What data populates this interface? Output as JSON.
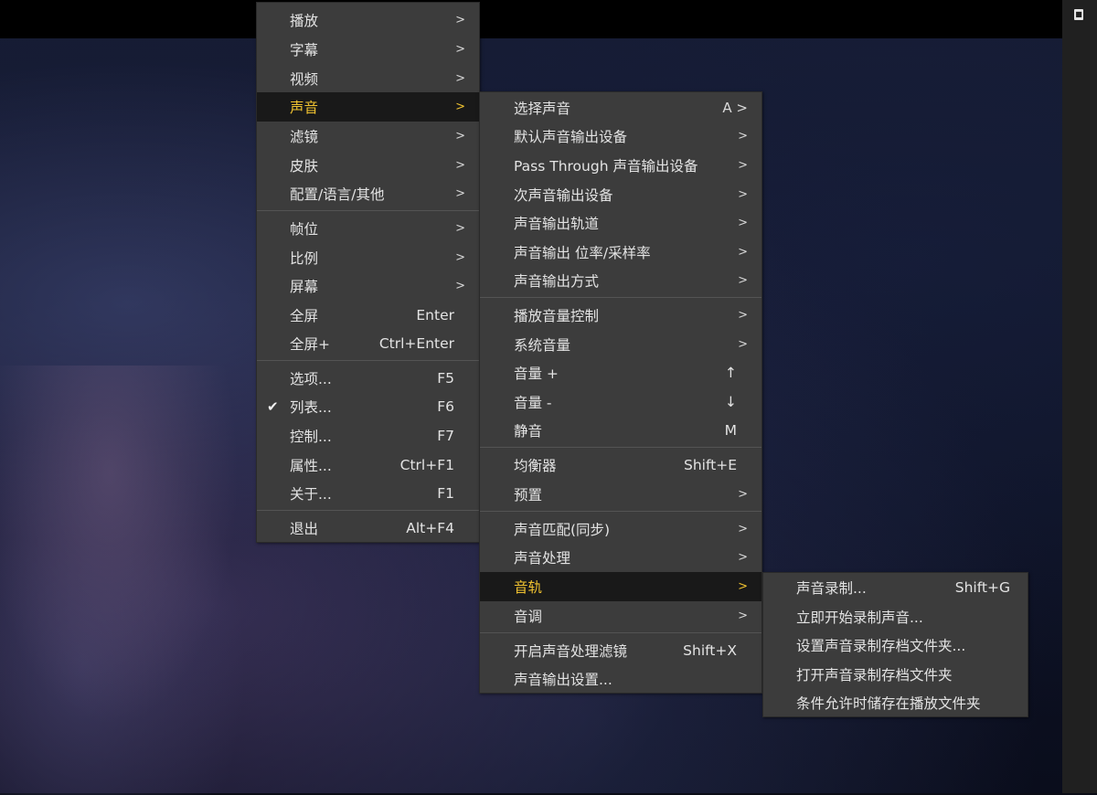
{
  "menu_main": {
    "items": [
      {
        "label": "播放",
        "arrow": ">"
      },
      {
        "label": "字幕",
        "arrow": ">"
      },
      {
        "label": "视频",
        "arrow": ">"
      },
      {
        "label": "声音",
        "arrow": ">"
      },
      {
        "label": "滤镜",
        "arrow": ">"
      },
      {
        "label": "皮肤",
        "arrow": ">"
      },
      {
        "label": "配置/语言/其他",
        "arrow": ">"
      },
      {
        "label": "帧位",
        "arrow": ">"
      },
      {
        "label": "比例",
        "arrow": ">"
      },
      {
        "label": "屏幕",
        "arrow": ">"
      },
      {
        "label": "全屏",
        "shortcut": "Enter"
      },
      {
        "label": "全屏+",
        "shortcut": "Ctrl+Enter"
      },
      {
        "label": "选项...",
        "shortcut": "F5"
      },
      {
        "label": "列表...",
        "shortcut": "F6",
        "checked": true,
        "check_glyph": "✔"
      },
      {
        "label": "控制...",
        "shortcut": "F7"
      },
      {
        "label": "属性...",
        "shortcut": "Ctrl+F1"
      },
      {
        "label": "关于...",
        "shortcut": "F1"
      },
      {
        "label": "退出",
        "shortcut": "Alt+F4"
      }
    ]
  },
  "menu_audio": {
    "items": [
      {
        "label": "选择声音",
        "arrow": "A >"
      },
      {
        "label": "默认声音输出设备",
        "arrow": ">"
      },
      {
        "label": "Pass Through 声音输出设备",
        "arrow": ">"
      },
      {
        "label": "次声音输出设备",
        "arrow": ">"
      },
      {
        "label": "声音输出轨道",
        "arrow": ">"
      },
      {
        "label": "声音输出 位率/采样率",
        "arrow": ">"
      },
      {
        "label": "声音输出方式",
        "arrow": ">"
      },
      {
        "label": "播放音量控制",
        "arrow": ">"
      },
      {
        "label": "系统音量",
        "arrow": ">"
      },
      {
        "label": "音量 +",
        "shortcut": "↑"
      },
      {
        "label": "音量 -",
        "shortcut": "↓"
      },
      {
        "label": "静音",
        "shortcut": "M"
      },
      {
        "label": "均衡器",
        "shortcut": "Shift+E"
      },
      {
        "label": "预置",
        "arrow": ">"
      },
      {
        "label": "声音匹配(同步)",
        "arrow": ">"
      },
      {
        "label": "声音处理",
        "arrow": ">"
      },
      {
        "label": "音轨",
        "arrow": ">"
      },
      {
        "label": "音调",
        "arrow": ">"
      },
      {
        "label": "开启声音处理滤镜",
        "shortcut": "Shift+X"
      },
      {
        "label": "声音输出设置..."
      }
    ]
  },
  "menu_recording": {
    "items": [
      {
        "label": "声音录制...",
        "shortcut": "Shift+G"
      },
      {
        "label": "立即开始录制声音..."
      },
      {
        "label": "设置声音录制存档文件夹..."
      },
      {
        "label": "打开声音录制存档文件夹"
      },
      {
        "label": "条件允许时储存在播放文件夹"
      }
    ]
  },
  "colors": {
    "menu_bg": "#3c3c3c",
    "highlight_bg": "#191919",
    "highlight_text": "#f0c230",
    "text": "#e3e3e3"
  }
}
